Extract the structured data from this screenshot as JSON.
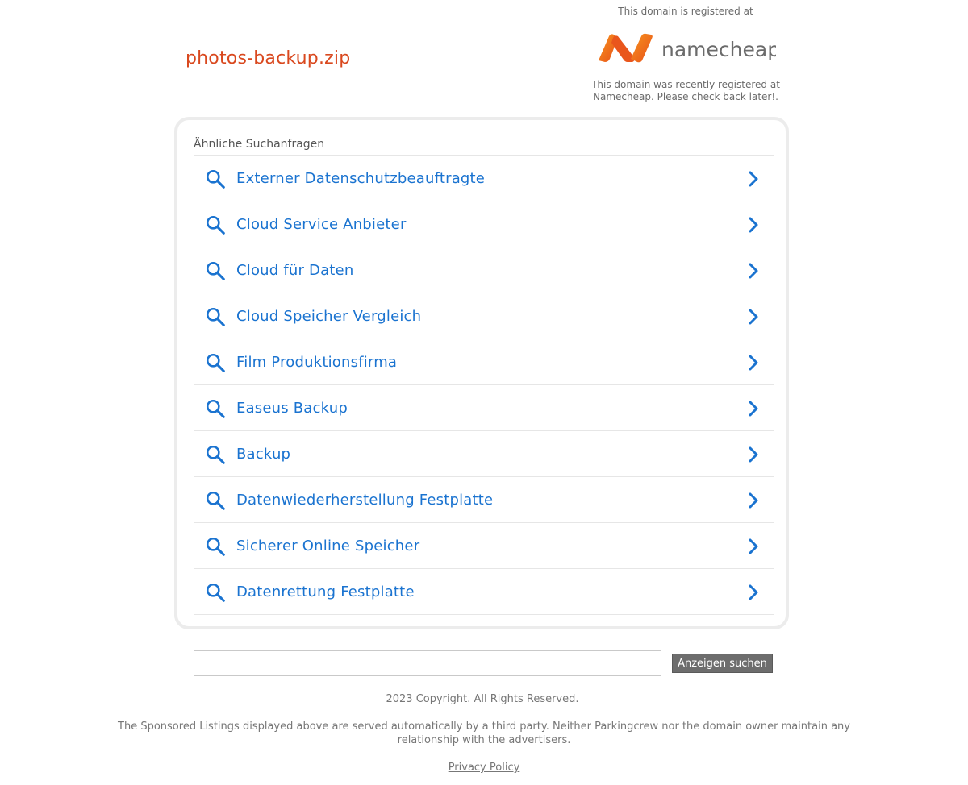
{
  "header": {
    "domain": "photos-backup.zip",
    "registrar_top": "This domain is registered at",
    "registrar_logo": "namecheap",
    "registrar_bottom": "This domain was recently registered at Namecheap. Please check back later!."
  },
  "related": {
    "heading": "Ähnliche Suchanfragen",
    "items": [
      {
        "label": "Externer Datenschutzbeauftragte",
        "icon": "search-icon"
      },
      {
        "label": "Cloud Service Anbieter",
        "icon": "search-icon"
      },
      {
        "label": "Cloud für Daten",
        "icon": "search-icon"
      },
      {
        "label": "Cloud Speicher Vergleich",
        "icon": "search-icon"
      },
      {
        "label": "Film Produktionsfirma",
        "icon": "search-icon"
      },
      {
        "label": "Easeus Backup",
        "icon": "search-icon"
      },
      {
        "label": "Backup",
        "icon": "search-icon"
      },
      {
        "label": "Datenwiederherstellung Festplatte",
        "icon": "search-icon"
      },
      {
        "label": "Sicherer Online Speicher",
        "icon": "search-icon"
      },
      {
        "label": "Datenrettung Festplatte",
        "icon": "search-icon"
      }
    ]
  },
  "search": {
    "value": "",
    "button_label": "Anzeigen suchen"
  },
  "footer": {
    "copyright": "2023 Copyright. All Rights Reserved.",
    "disclaimer": "The Sponsored Listings displayed above are served automatically by a third party. Neither Parkingcrew nor the domain owner maintain any relationship with the advertisers.",
    "privacy_label": "Privacy Policy"
  },
  "colors": {
    "domain_title": "#d9481e",
    "link_blue": "#1a73d0",
    "logo_orange": "#f26522"
  }
}
